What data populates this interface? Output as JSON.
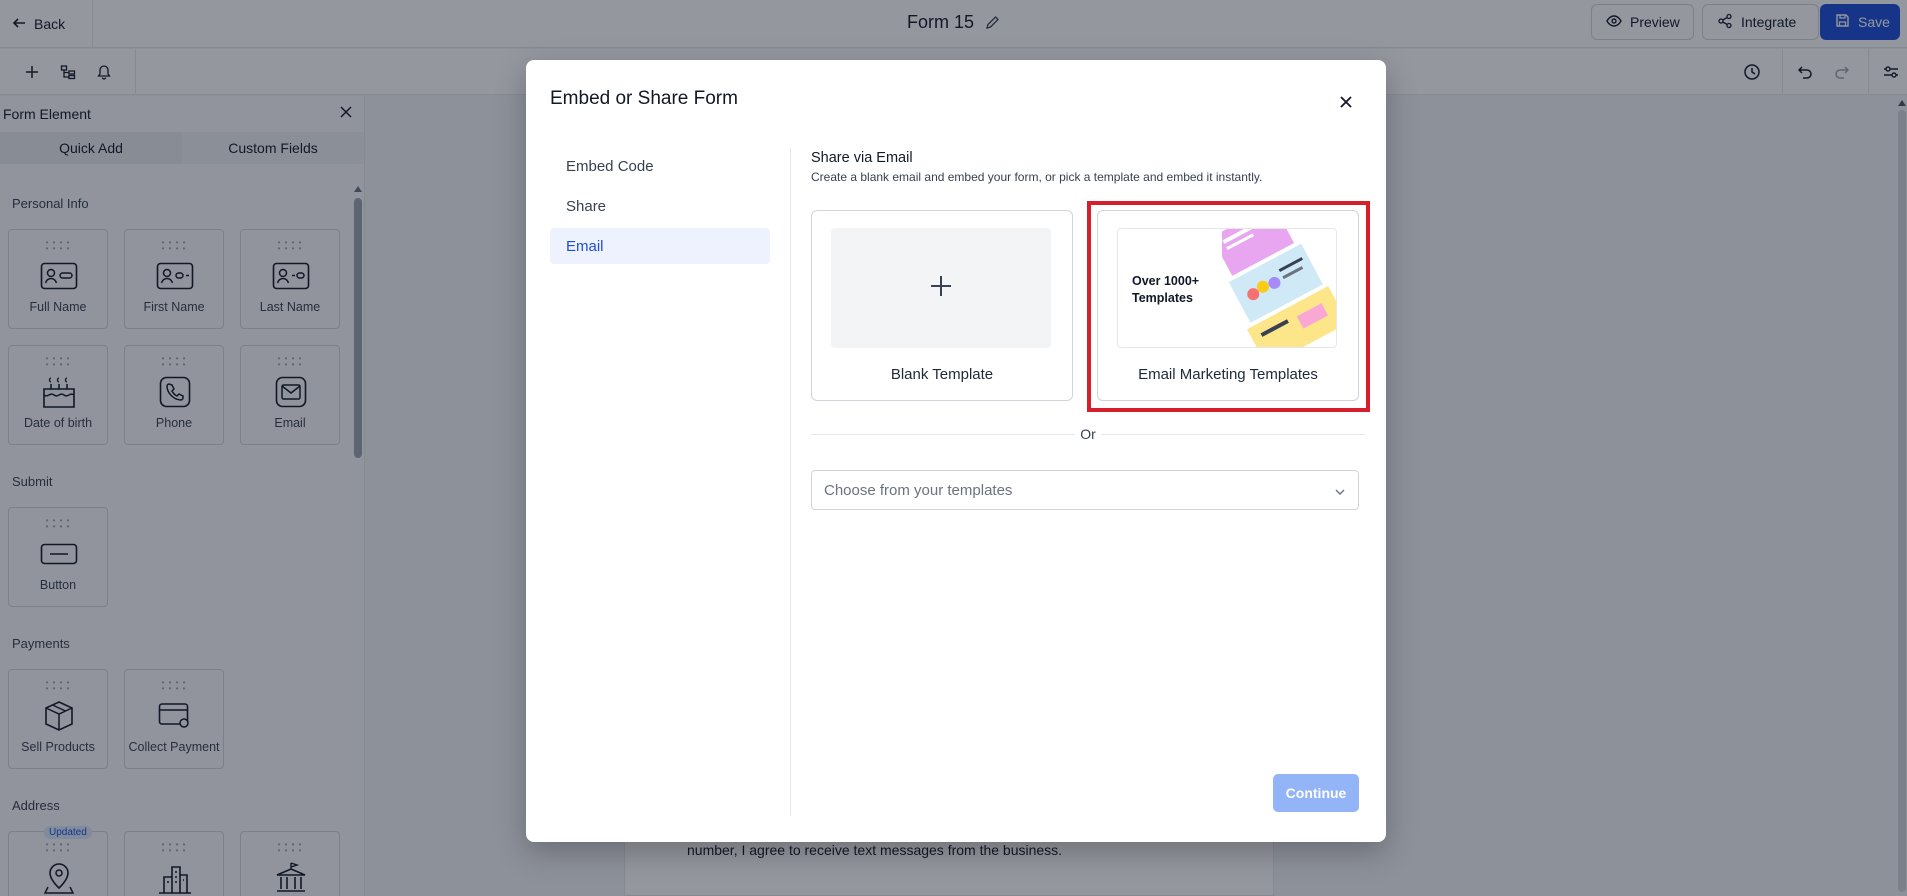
{
  "header": {
    "back_label": "Back",
    "form_title": "Form 15",
    "preview_label": "Preview",
    "integrate_label": "Integrate",
    "save_label": "Save"
  },
  "left_panel": {
    "title": "Form Element",
    "tabs": [
      "Quick Add",
      "Custom Fields"
    ],
    "sections": {
      "personal_info": "Personal Info",
      "submit": "Submit",
      "payments": "Payments",
      "address": "Address"
    },
    "elements": {
      "full_name": "Full Name",
      "first_name": "First Name",
      "last_name": "Last Name",
      "date_of_birth": "Date of birth",
      "phone": "Phone",
      "email": "Email",
      "button": "Button",
      "sell_products": "Sell Products",
      "collect_payment": "Collect Payment"
    },
    "updated_badge": "Updated"
  },
  "canvas": {
    "consent_text": "number, I agree to receive text messages from the business."
  },
  "modal": {
    "title": "Embed or Share Form",
    "nav": [
      "Embed Code",
      "Share",
      "Email"
    ],
    "active_nav": "Email",
    "heading": "Share via Email",
    "subheading": "Create a blank email and embed your form, or pick a template and embed it instantly.",
    "blank_template_label": "Blank Template",
    "email_templates_label": "Email Marketing Templates",
    "promo_text": "Over 1000+ Templates",
    "or_label": "Or",
    "select_placeholder": "Choose from your templates",
    "continue_label": "Continue"
  },
  "colors": {
    "primary": "#1d4ed8",
    "continue_disabled": "#93b4f7",
    "highlight": "#d61f2c"
  }
}
